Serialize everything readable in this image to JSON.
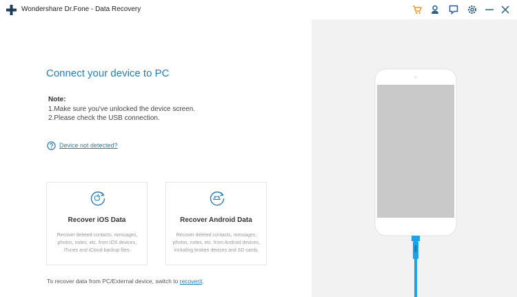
{
  "window": {
    "title": "Wondershare Dr.Fone - Data Recovery",
    "icons": [
      "cart-icon",
      "user-icon",
      "feedback-icon",
      "settings-icon",
      "minimize-icon",
      "close-icon"
    ]
  },
  "main": {
    "heading": "Connect your device to PC",
    "note_title": "Note:",
    "note_lines": [
      "1.Make sure you've unlocked the device screen.",
      "2.Please check the USB connection."
    ],
    "help_link": "Device not detected?",
    "cards": [
      {
        "title": "Recover iOS Data",
        "description": "Recover deleted contacts, messages, photos, notes, etc. from iOS devices, iTunes and iCloud backup files."
      },
      {
        "title": "Recover Android Data",
        "description": "Recover deleted contacts, messages, photos, notes, etc. from Android devices, including broken devices and SD cards."
      }
    ],
    "footer_text": "To recover data from PC/External device, switch to ",
    "footer_link": "recoverit",
    "footer_end": "."
  },
  "colors": {
    "accent": "#2b7ab6",
    "cable": "#1aa3e8",
    "right_panel": "#f2f2f2"
  }
}
